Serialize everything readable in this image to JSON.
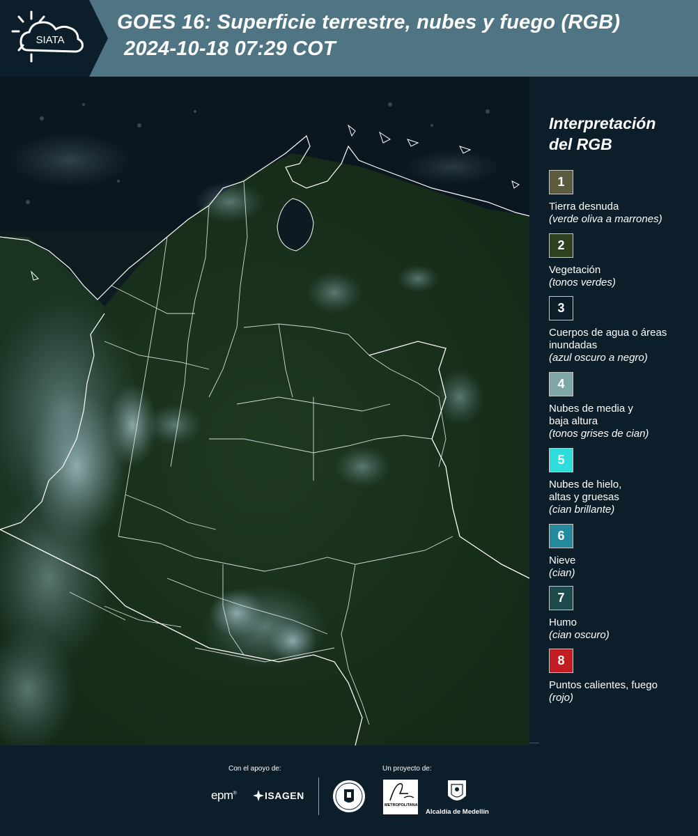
{
  "header": {
    "logo_text": "SIATA",
    "title_line1": "GOES 16: Superficie terrestre, nubes y fuego (RGB)",
    "title_line2": "2024-10-18 07:29 COT"
  },
  "legend": {
    "title_line1": "Interpretación",
    "title_line2": "del RGB",
    "items": [
      {
        "num": "1",
        "color": "#5b5a3e",
        "label": "Tierra desnuda",
        "sub": "(verde oliva a marrones)"
      },
      {
        "num": "2",
        "color": "#2f4220",
        "label": "Vegetación",
        "sub": "(tonos verdes)"
      },
      {
        "num": "3",
        "color": "#0c1e2a",
        "label": "Cuerpos de agua o áreas inundadas",
        "sub": "(azul oscuro a negro)"
      },
      {
        "num": "4",
        "color": "#7fa7a8",
        "label": "Nubes de media y baja altura",
        "sub": "(tonos grises de cian)"
      },
      {
        "num": "5",
        "color": "#2fdcdc",
        "label": "Nubes de hielo, altas y gruesas",
        "sub": "(cian brillante)"
      },
      {
        "num": "6",
        "color": "#248a9e",
        "label": "Nieve",
        "sub": "(cian)"
      },
      {
        "num": "7",
        "color": "#1d4a4c",
        "label": "Humo",
        "sub": "(cian oscuro)"
      },
      {
        "num": "8",
        "color": "#c21d22",
        "label": "Puntos calientes, fuego",
        "sub": "(rojo)"
      }
    ]
  },
  "footer": {
    "support_label": "Con el apoyo de:",
    "project_label": "Un proyecto de:",
    "epm": "epm",
    "isagen": "ISAGEN",
    "metropolitana": "METROPOLITANA",
    "alcaldia": "Alcaldía de Medellín"
  }
}
